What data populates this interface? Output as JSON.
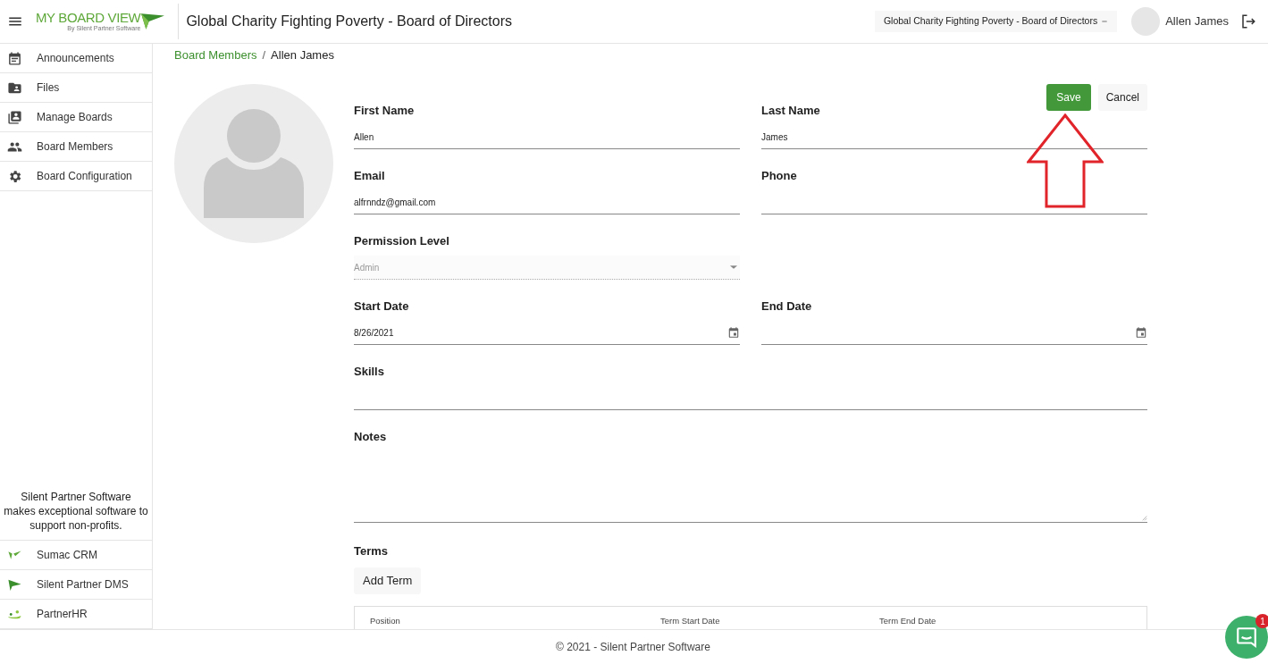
{
  "header": {
    "logo_text": "MY BOARD VIEW",
    "logo_subtext": "By Silent Partner Software",
    "title": "Global Charity Fighting Poverty - Board of Directors",
    "board_selector": "Global Charity Fighting Poverty - Board of Directors",
    "user_name": "Allen James"
  },
  "sidebar": {
    "items": [
      {
        "label": "Announcements"
      },
      {
        "label": "Files"
      },
      {
        "label": "Manage Boards"
      },
      {
        "label": "Board Members"
      },
      {
        "label": "Board Configuration"
      }
    ],
    "promo": "Silent Partner Software makes exceptional software to support non-profits.",
    "products": [
      {
        "label": "Sumac CRM"
      },
      {
        "label": "Silent Partner DMS"
      },
      {
        "label": "PartnerHR"
      }
    ]
  },
  "breadcrumb": {
    "separator": "/",
    "items": [
      {
        "label": "Board Members",
        "link": true
      },
      {
        "label": "Allen James",
        "link": false
      }
    ]
  },
  "buttons": [
    {
      "label": "Save",
      "primary": true
    },
    {
      "label": "Cancel",
      "primary": false
    }
  ],
  "fields": [
    {
      "label": "First Name",
      "kind": "text",
      "value": "Allen",
      "disabled": false
    },
    {
      "label": "Last Name",
      "kind": "text",
      "value": "James",
      "disabled": false
    },
    {
      "label": "Email",
      "kind": "text",
      "value": "alfrnndz@gmail.com",
      "disabled": false
    },
    {
      "label": "Phone",
      "kind": "text",
      "disabled": false
    },
    {
      "label": "Permission Level",
      "kind": "select",
      "value": "Admin",
      "disabled": true
    },
    {
      "label": "Start Date",
      "kind": "date",
      "value": "8/26/2021",
      "disabled": false
    },
    {
      "label": "End Date",
      "kind": "date",
      "disabled": false
    },
    {
      "label": "Skills",
      "kind": "longtext",
      "disabled": false
    },
    {
      "label": "Notes",
      "kind": "textarea",
      "disabled": false
    }
  ],
  "terms": {
    "title": "Terms",
    "add_button": "Add Term",
    "columns": [
      "Position",
      "Term Start Date",
      "Term End Date"
    ]
  },
  "footer": "© 2021 - Silent Partner Software",
  "chat": {
    "badge": "1"
  }
}
